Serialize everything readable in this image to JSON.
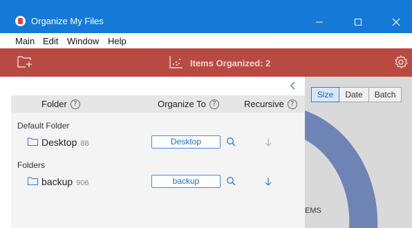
{
  "window": {
    "title": "Organize My Files"
  },
  "menu": {
    "items": [
      "Main",
      "Edit",
      "Window",
      "Help"
    ]
  },
  "toolbar": {
    "items_organized": "Items Organized: 2"
  },
  "view_tabs": [
    "Size",
    "Date",
    "Batch"
  ],
  "chart_fragment": "EMS",
  "panel": {
    "columns": {
      "folder": "Folder",
      "organize_to": "Organize To",
      "recursive": "Recursive"
    },
    "help_glyph": "?",
    "default_section": "Default Folder",
    "folders_section": "Folders",
    "rows": [
      {
        "name": "Desktop",
        "count": "88",
        "destination": "Desktop",
        "recursive": false
      },
      {
        "name": "backup",
        "count": "906",
        "destination": "backup",
        "recursive": true
      }
    ]
  },
  "colors": {
    "titlebar": "#1479d7",
    "toolbar": "#b84a42",
    "accent": "#2f7ad6",
    "donut": "#6e84b5",
    "arrow_active": "#2f7ad6",
    "arrow_inactive": "#b0b0b0"
  },
  "icons": [
    "app-icon",
    "minimize-icon",
    "maximize-icon",
    "close-icon",
    "add-folder-icon",
    "stats-icon",
    "gear-icon",
    "chevron-left-icon",
    "help-icon",
    "folder-icon",
    "search-icon",
    "arrow-down-icon"
  ]
}
